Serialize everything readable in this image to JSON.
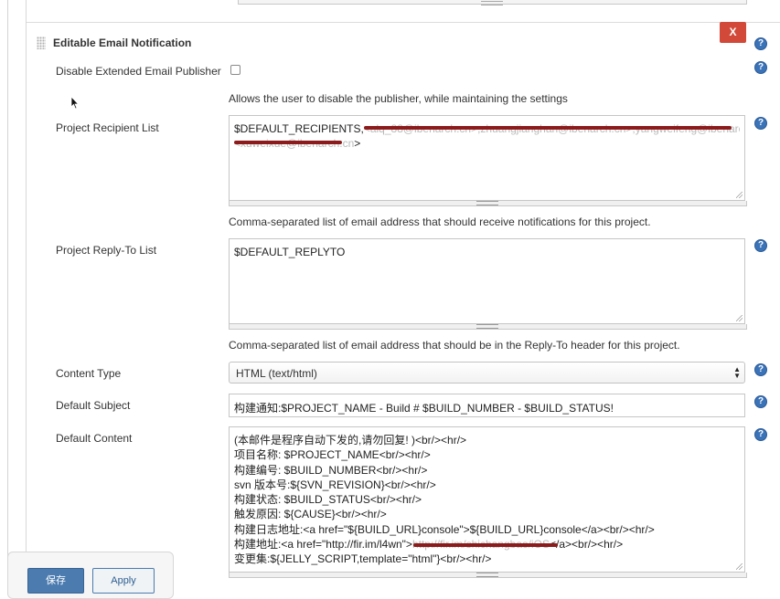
{
  "section": {
    "title": "Editable Email Notification",
    "delete_label": "X"
  },
  "fields": {
    "disable_publisher": {
      "label": "Disable Extended Email Publisher",
      "checked": false,
      "description": "Allows the user to disable the publisher, while maintaining the settings"
    },
    "recipient_list": {
      "label": "Project Recipient List",
      "value_visible": "$DEFAULT_RECIPIENTS,",
      "value_line1_obscured": "<alq_88@ibenarch.cn>,zhuangjianghan@ibenarch.cn>,yangweifeng@ibenarch.cn>",
      "value_line2_obscured": "<xuweixue@ibenarch.cn",
      "value_line2_tail": ">",
      "description": "Comma-separated list of email address that should receive notifications for this project."
    },
    "reply_to_list": {
      "label": "Project Reply-To List",
      "value": "$DEFAULT_REPLYTO",
      "description": "Comma-separated list of email address that should be in the Reply-To header for this project."
    },
    "content_type": {
      "label": "Content Type",
      "selected": "HTML (text/html)"
    },
    "default_subject": {
      "label": "Default Subject",
      "value": "构建通知:$PROJECT_NAME - Build # $BUILD_NUMBER - $BUILD_STATUS!"
    },
    "default_content": {
      "label": "Default Content",
      "lines": [
        "(本邮件是程序自动下发的,请勿回复! )<br/><hr/>",
        "项目名称: $PROJECT_NAME<br/><hr/>",
        "构建编号: $BUILD_NUMBER<br/><hr/>",
        "svn 版本号:${SVN_REVISION}<br/><hr/>",
        "构建状态: $BUILD_STATUS<br/><hr/>",
        "触发原因: ${CAUSE}<br/><hr/>",
        "构建日志地址:<a href=\"${BUILD_URL}console\">${BUILD_URL}console</a><br/><hr/>",
        "变更集:${JELLY_SCRIPT,template=\"html\"}<br/><hr/>"
      ],
      "line8_prefix": " 构建地址:<a href=\"http://fir.im/l4wn\">",
      "line8_obscured": "http://fir.im/shichangbao/iOS",
      "line8_suffix": "</a><br/><hr/>"
    }
  },
  "help_icon_glyph": "?",
  "buttons": {
    "save": "保存",
    "apply": "Apply"
  },
  "colors": {
    "accent": "#3b73b9",
    "delete": "#d24939",
    "redaction": "#8d1b1b"
  }
}
